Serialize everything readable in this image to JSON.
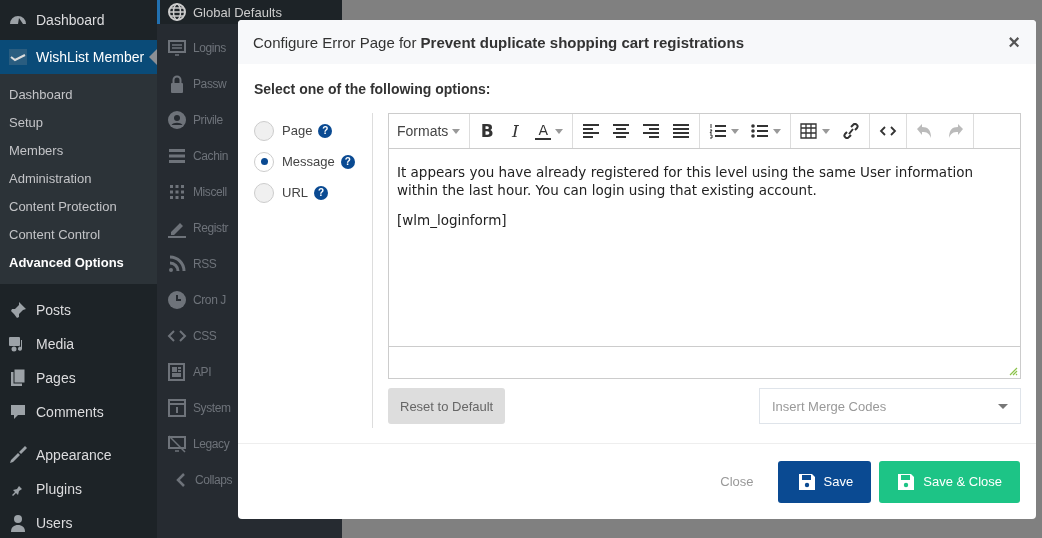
{
  "sidebar": {
    "groups": [
      [
        {
          "label": "Dashboard",
          "selected": false
        },
        {
          "label": "WishList Member",
          "selected": true,
          "children": [
            {
              "label": "Dashboard",
              "selected": false
            },
            {
              "label": "Setup",
              "selected": false
            },
            {
              "label": "Members",
              "selected": false
            },
            {
              "label": "Administration",
              "selected": false
            },
            {
              "label": "Content Protection",
              "selected": false
            },
            {
              "label": "Content Control",
              "selected": false
            },
            {
              "label": "Advanced Options",
              "selected": true
            }
          ]
        }
      ],
      [
        {
          "label": "Posts",
          "selected": false
        },
        {
          "label": "Media",
          "selected": false
        },
        {
          "label": "Pages",
          "selected": false
        },
        {
          "label": "Comments",
          "selected": false
        }
      ],
      [
        {
          "label": "Appearance",
          "selected": false
        },
        {
          "label": "Plugins",
          "selected": false
        },
        {
          "label": "Users",
          "selected": false
        }
      ]
    ]
  },
  "submenu": {
    "items": [
      {
        "label": "Global Defaults",
        "selected": true
      },
      {
        "label": "Logins",
        "selected": false
      },
      {
        "label": "Passw",
        "selected": false
      },
      {
        "label": "Privile",
        "selected": false
      },
      {
        "label": "Cachin",
        "selected": false
      },
      {
        "label": "Miscell",
        "selected": false
      },
      {
        "label": "Registr",
        "selected": false
      },
      {
        "label": "RSS",
        "selected": false
      },
      {
        "label": "Cron J",
        "selected": false
      },
      {
        "label": "CSS",
        "selected": false
      },
      {
        "label": "API",
        "selected": false
      },
      {
        "label": "System",
        "selected": false
      },
      {
        "label": "Legacy",
        "selected": false
      },
      {
        "label": "Collaps",
        "selected": false
      }
    ]
  },
  "dialog": {
    "title": "Configure Error Page for **Prevent duplicate shopping cart registrations**",
    "close": "×",
    "prompt": "Select one of the following options:",
    "options": [
      {
        "label": "Page",
        "selected": false,
        "help": "?"
      },
      {
        "label": "Message",
        "selected": true,
        "help": "?"
      },
      {
        "label": "URL",
        "selected": false,
        "help": "?"
      }
    ],
    "editor": {
      "toolbar": [
        [
          {
            "kind": "formats",
            "label": "Formats",
            "dropdown": true,
            "disabled": false
          }
        ],
        [
          {
            "kind": "bold",
            "label": "B",
            "dropdown": false,
            "disabled": false
          },
          {
            "kind": "italic",
            "label": "I",
            "dropdown": false,
            "disabled": false
          },
          {
            "kind": "text_color",
            "label": "A",
            "dropdown": true,
            "disabled": false
          }
        ],
        [
          {
            "kind": "align_left",
            "dropdown": false,
            "disabled": false
          },
          {
            "kind": "align_center",
            "dropdown": false,
            "disabled": false
          },
          {
            "kind": "align_right",
            "dropdown": false,
            "disabled": false
          },
          {
            "kind": "justify",
            "dropdown": false,
            "disabled": false
          }
        ],
        [
          {
            "kind": "numbered_list",
            "dropdown": true,
            "disabled": false
          },
          {
            "kind": "bullet_list",
            "dropdown": true,
            "disabled": false
          }
        ],
        [
          {
            "kind": "table",
            "dropdown": true,
            "disabled": false
          },
          {
            "kind": "link",
            "dropdown": false,
            "disabled": false
          }
        ],
        [
          {
            "kind": "code",
            "dropdown": false,
            "disabled": false
          }
        ],
        [
          {
            "kind": "undo",
            "dropdown": false,
            "disabled": true
          },
          {
            "kind": "redo",
            "dropdown": false,
            "disabled": true
          }
        ]
      ],
      "paragraphs": [
        "It appears you have already registered for this level using the same User information within the last hour. You can login using that existing account.",
        "[wlm_loginform]"
      ]
    },
    "reset_button": "Reset to Default",
    "merge_codes": {
      "placeholder": "Insert Merge Codes"
    },
    "footer_buttons": [
      {
        "label": "Close",
        "kind": "link"
      },
      {
        "label": "Save",
        "kind": "primary"
      },
      {
        "label": "Save & Close",
        "kind": "success"
      }
    ]
  }
}
